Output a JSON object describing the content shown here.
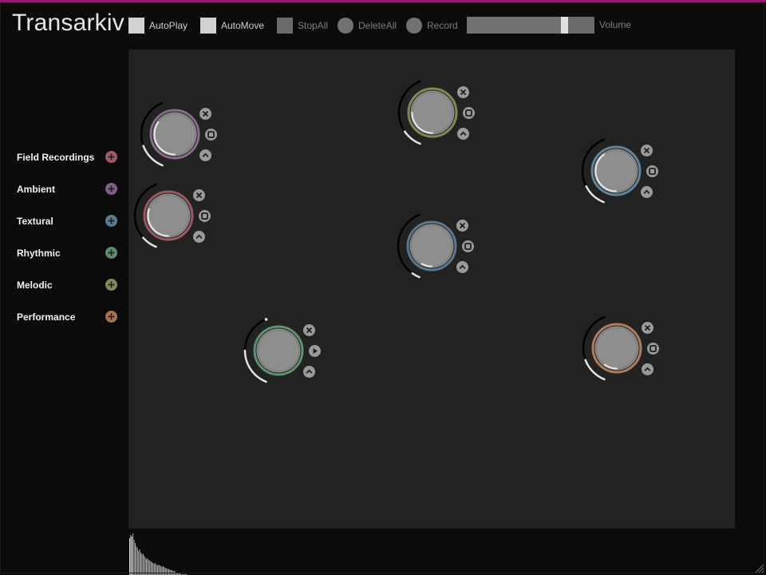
{
  "app": {
    "title": "Transarkiv"
  },
  "toolbar": {
    "autoplay": {
      "label": "AutoPlay",
      "enabled": true
    },
    "automove": {
      "label": "AutoMove",
      "enabled": true
    },
    "stopall": {
      "label": "StopAll",
      "enabled": false
    },
    "deleteall": {
      "label": "DeleteAll",
      "enabled": false
    },
    "record": {
      "label": "Record",
      "enabled": false
    },
    "volume": {
      "label": "Volume",
      "level": 0.78
    }
  },
  "categories": [
    {
      "label": "Field Recordings",
      "color": "#9e5c66"
    },
    {
      "label": "Ambient",
      "color": "#7f5f86"
    },
    {
      "label": "Textural",
      "color": "#5a7d94"
    },
    {
      "label": "Rhythmic",
      "color": "#5f8a6c"
    },
    {
      "label": "Melodic",
      "color": "#7f8a5a"
    },
    {
      "label": "Performance",
      "color": "#a9704f"
    }
  ],
  "players": [
    {
      "category": "Ambient",
      "ring": "#8a6b8e",
      "state": "playing",
      "progress": 0.35,
      "volume": 0.35
    },
    {
      "category": "Field Recordings",
      "ring": "#9a5a62",
      "state": "playing",
      "progress": 0.3,
      "volume": 0.2
    },
    {
      "category": "Melodic",
      "ring": "#7f8a55",
      "state": "playing",
      "progress": 0.25,
      "volume": 0.25
    },
    {
      "category": "Textural",
      "ring": "#62849a",
      "state": "playing",
      "progress": 0.4,
      "volume": 0.3
    },
    {
      "category": "Textural",
      "ring": "#5b7890",
      "state": "playing",
      "progress": 0.08,
      "volume": 0.1
    },
    {
      "category": "Rhythmic",
      "ring": "#5f9272",
      "state": "stopped",
      "progress": 0.0,
      "volume": 0.5
    },
    {
      "category": "Performance",
      "ring": "#b07c5a",
      "state": "playing",
      "progress": 0.1,
      "volume": 0.35
    }
  ],
  "icons": {
    "add": "plus-circle-icon",
    "remove": "close-icon",
    "stop": "stop-icon",
    "play": "play-icon",
    "move": "chevron-up-icon"
  }
}
